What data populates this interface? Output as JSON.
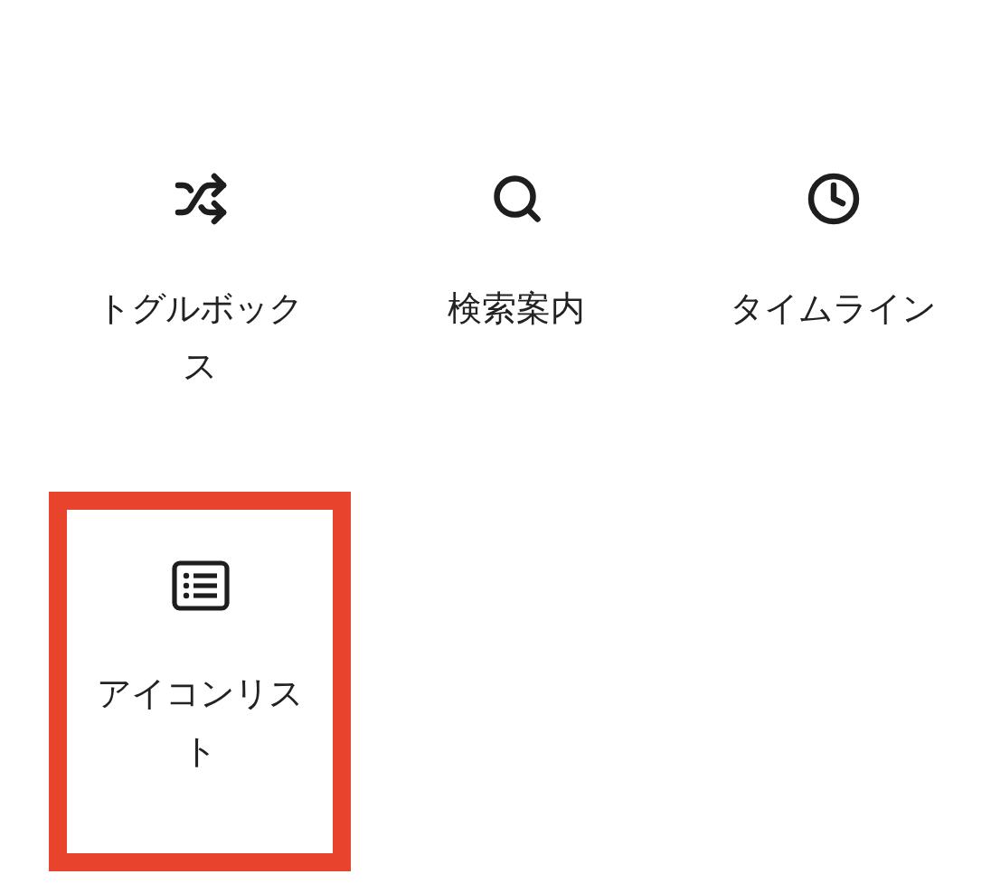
{
  "items": [
    {
      "label": "トグルボックス",
      "kind": "shuffle",
      "selected": false
    },
    {
      "label": "検索案内",
      "kind": "search",
      "selected": false
    },
    {
      "label": "タイムライン",
      "kind": "clock",
      "selected": false
    },
    {
      "label": "アイコンリスト",
      "kind": "list",
      "selected": true
    }
  ]
}
